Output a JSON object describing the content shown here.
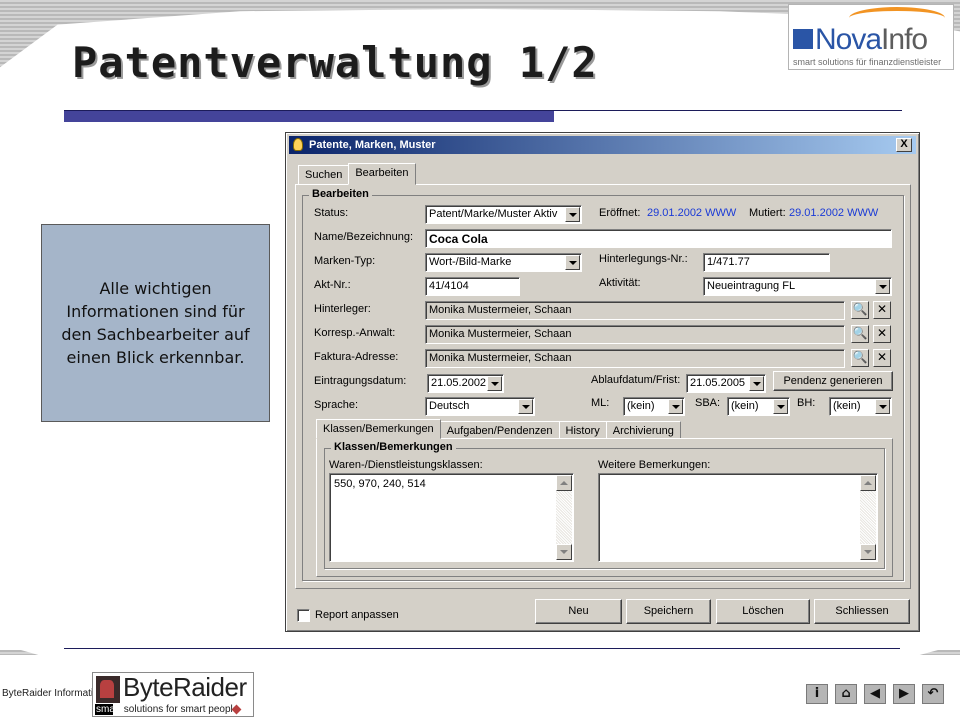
{
  "slide": {
    "title": "Patentverwaltung 1/2",
    "callout": "Alle wichtigen Informationen sind für den Sachbearbeiter auf einen Blick erkennbar."
  },
  "logo": {
    "nova_left": "Nova",
    "nova_right": "Info",
    "nova_tagline": "smart solutions für finanzdienstleister",
    "byteraider_company": "ByteRaider Informatik AG",
    "byteraider_name": "ByteRaider",
    "byteraider_tagline_prefix": "smart",
    "byteraider_tagline": "solutions for smart people"
  },
  "window": {
    "title": "Patente, Marken, Muster",
    "close": "X",
    "tabs": [
      "Suchen",
      "Bearbeiten"
    ],
    "group_title": "Bearbeiten",
    "labels": {
      "status": "Status:",
      "eroeffnet": "Eröffnet:",
      "mutiert": "Mutiert:",
      "name": "Name/Bezeichnung:",
      "markentyp": "Marken-Typ:",
      "hinterlegungsnr": "Hinterlegungs-Nr.:",
      "aktnr": "Akt-Nr.:",
      "aktivitaet": "Aktivität:",
      "hinterleger": "Hinterleger:",
      "korresp": "Korresp.-Anwalt:",
      "faktura": "Faktura-Adresse:",
      "eintragung": "Eintragungsdatum:",
      "ablauf": "Ablaufdatum/Frist:",
      "sprache": "Sprache:",
      "ml": "ML:",
      "sba": "SBA:",
      "bh": "BH:"
    },
    "values": {
      "status": "Patent/Marke/Muster Aktiv",
      "eroeffnet": "29.01.2002 WWW",
      "mutiert": "29.01.2002 WWW",
      "name": "Coca Cola",
      "markentyp": "Wort-/Bild-Marke",
      "hinterlegungsnr": "1/471.77",
      "aktnr": "41/4104",
      "aktivitaet": "Neueintragung FL",
      "hinterleger": "Monika Mustermeier, Schaan",
      "korresp": "Monika Mustermeier, Schaan",
      "faktura": "Monika Mustermeier, Schaan",
      "eintragung": "21.05.2002",
      "ablauf": "21.05.2005",
      "sprache": "Deutsch",
      "ml": "(kein)",
      "sba": "(kein)",
      "bh": "(kein)"
    },
    "pendenz_button": "Pendenz generieren",
    "subtabs": [
      "Klassen/Bemerkungen",
      "Aufgaben/Pendenzen",
      "History",
      "Archivierung"
    ],
    "sub_group_title": "Klassen/Bemerkungen",
    "waren_label": "Waren-/Dienstleistungsklassen:",
    "waren_value": "550, 970, 240, 514",
    "bemerkungen_label": "Weitere Bemerkungen:",
    "bemerkungen_value": "",
    "report_label": "Report anpassen",
    "buttons": {
      "neu": "Neu",
      "speichern": "Speichern",
      "loeschen": "Löschen",
      "schliessen": "Schliessen"
    }
  },
  "nav_icons": [
    "info-icon",
    "home-icon",
    "previous-icon",
    "next-icon",
    "return-icon"
  ],
  "colors": {
    "accent_blue": "#44449a",
    "callout_bg": "#a5b5c9",
    "link_blue": "#1a3ad6",
    "titlebar": "#0a246a"
  }
}
